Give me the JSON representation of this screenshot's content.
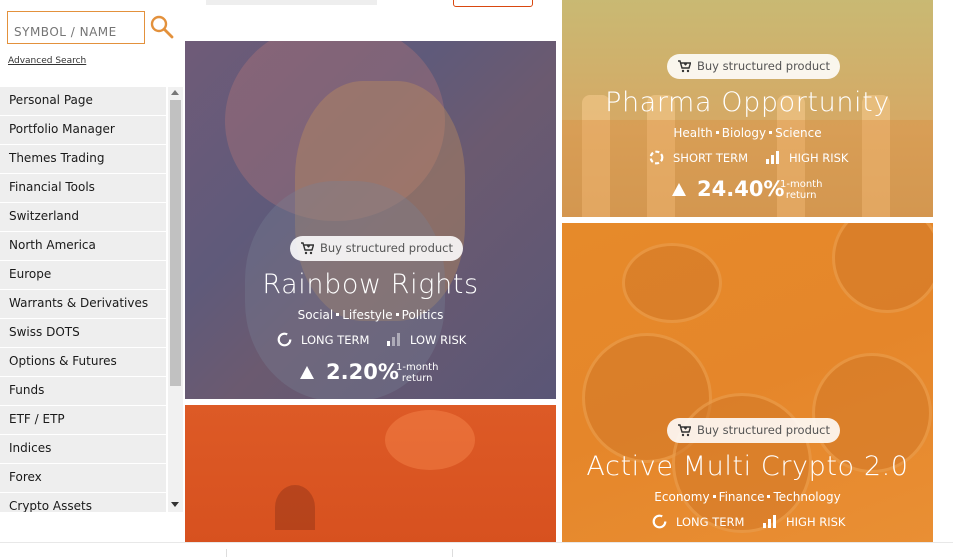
{
  "search": {
    "placeholder": "SYMBOL / NAME",
    "advanced_link": "Advanced Search"
  },
  "nav": {
    "items": [
      "Personal Page",
      "Portfolio Manager",
      "Themes Trading",
      "Financial Tools",
      "Switzerland",
      "North America",
      "Europe",
      "Warrants & Derivatives",
      "Swiss DOTS",
      "Options & Futures",
      "Funds",
      "ETF / ETP",
      "Indices",
      "Forex",
      "Crypto Assets"
    ]
  },
  "cards": {
    "rainbow": {
      "buy_label": "Buy structured product",
      "title": "Rainbow Rights",
      "tags": [
        "Social",
        "Lifestyle",
        "Politics"
      ],
      "term": "LONG TERM",
      "risk": "LOW RISK",
      "return_value": "2.20%",
      "return_label_1": "1-month",
      "return_label_2": "return"
    },
    "pharma": {
      "buy_label": "Buy structured product",
      "title": "Pharma Opportunity",
      "tags": [
        "Health",
        "Biology",
        "Science"
      ],
      "term": "SHORT TERM",
      "risk": "HIGH RISK",
      "return_value": "24.40%",
      "return_label_1": "1-month",
      "return_label_2": "return"
    },
    "crypto": {
      "buy_label": "Buy structured product",
      "title": "Active Multi Crypto 2.0",
      "tags": [
        "Economy",
        "Finance",
        "Technology"
      ],
      "term": "LONG TERM",
      "risk": "HIGH RISK"
    }
  },
  "colors": {
    "accent": "#e3913c",
    "nav_bg": "#eeeeee",
    "crypto_bg": "#e68a2a",
    "rainbow_bg": "#5f5a7a"
  }
}
